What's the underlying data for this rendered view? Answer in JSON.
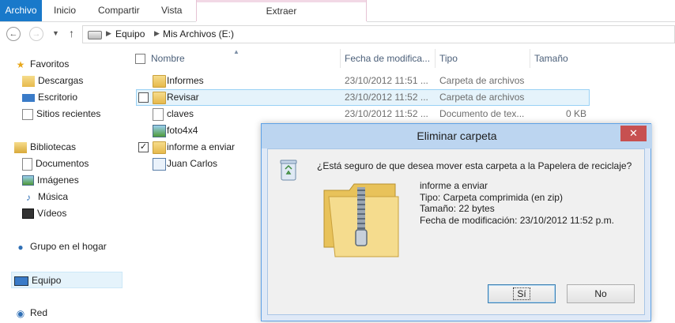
{
  "ribbon": {
    "tabs": [
      "Archivo",
      "Inicio",
      "Compartir",
      "Vista"
    ],
    "context_tab": "Extraer"
  },
  "address_bar": {
    "crumbs": [
      "Equipo",
      "Mis Archivos (E:)"
    ]
  },
  "nav_pane": {
    "favorites": {
      "label": "Favoritos",
      "items": [
        "Descargas",
        "Escritorio",
        "Sitios recientes"
      ]
    },
    "libraries": {
      "label": "Bibliotecas",
      "items": [
        "Documentos",
        "Imágenes",
        "Música",
        "Vídeos"
      ]
    },
    "homegroup": "Grupo en el hogar",
    "computer": "Equipo",
    "network": "Red"
  },
  "file_list": {
    "columns": [
      "Nombre",
      "Fecha de modifica...",
      "Tipo",
      "Tamaño"
    ],
    "rows": [
      {
        "name": "Informes",
        "date": "23/10/2012 11:51 ...",
        "type": "Carpeta de archivos",
        "size": "",
        "icon": "folder-icon"
      },
      {
        "name": "Revisar",
        "date": "23/10/2012 11:52 ...",
        "type": "Carpeta de archivos",
        "size": "",
        "icon": "folder-icon"
      },
      {
        "name": "claves",
        "date": "23/10/2012 11:52 ...",
        "type": "Documento de tex...",
        "size": "0 KB",
        "icon": "text-document-icon"
      },
      {
        "name": "foto4x4",
        "date": "",
        "type": "",
        "size": "",
        "icon": "image-icon"
      },
      {
        "name": "informe a enviar",
        "date": "",
        "type": "",
        "size": "",
        "icon": "zip-folder-icon"
      },
      {
        "name": "Juan Carlos",
        "date": "",
        "type": "",
        "size": "",
        "icon": "contact-card-icon"
      }
    ]
  },
  "dialog": {
    "title": "Eliminar carpeta",
    "close": "✕",
    "question": "¿Está seguro de que desea mover esta carpeta a la Papelera de reciclaje?",
    "details": {
      "name": "informe a enviar",
      "type": "Tipo: Carpeta comprimida (en zip)",
      "size": "Tamaño: 22 bytes",
      "modified": "Fecha de modificación: 23/10/2012 11:52 p.m."
    },
    "yes": "Sí",
    "no": "No"
  },
  "colors": {
    "file_tab": "#1979ca",
    "dialog_frame": "#5da1e6",
    "close_button": "#c75050",
    "selection": "#e5f3fb"
  }
}
